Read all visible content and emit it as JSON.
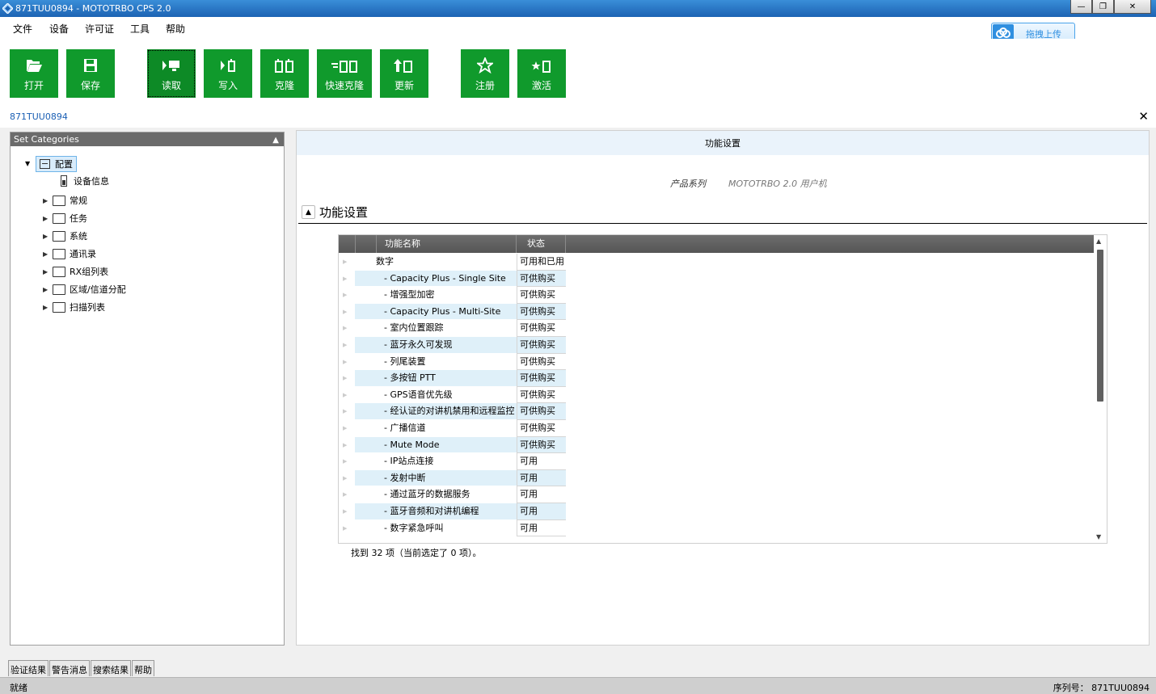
{
  "window": {
    "title": "871TUU0894 - MOTOTRBO CPS 2.0"
  },
  "menu": [
    "文件",
    "设备",
    "许可证",
    "工具",
    "帮助"
  ],
  "upload_label": "拖拽上传",
  "toolbar": {
    "open": "打开",
    "save": "保存",
    "read": "读取",
    "write": "写入",
    "clone": "克隆",
    "quick_clone": "快速克隆",
    "update": "更新",
    "register": "注册",
    "activate": "激活"
  },
  "doc_tab": "871TUU0894",
  "left_panel": {
    "title": "Set Categories",
    "root": "配置",
    "device_info": "设备信息",
    "items": [
      "常规",
      "任务",
      "系统",
      "通讯录",
      "RX组列表",
      "区域/信道分配",
      "扫描列表"
    ]
  },
  "right_panel": {
    "header": "功能设置",
    "product_series_label": "产品系列",
    "product_series_value": "MOTOTRBO 2.0 用户机",
    "section_title": "功能设置"
  },
  "grid": {
    "col_name": "功能名称",
    "col_status": "状态",
    "rows": [
      {
        "name": "数字",
        "status": "可用和已用"
      },
      {
        "name": "- Capacity Plus - Single Site",
        "status": "可供购买"
      },
      {
        "name": "- 增强型加密",
        "status": "可供购买"
      },
      {
        "name": "- Capacity Plus - Multi-Site",
        "status": "可供购买"
      },
      {
        "name": "- 室内位置跟踪",
        "status": "可供购买"
      },
      {
        "name": "- 蓝牙永久可发现",
        "status": "可供购买"
      },
      {
        "name": "- 列尾装置",
        "status": "可供购买"
      },
      {
        "name": "- 多按钮 PTT",
        "status": "可供购买"
      },
      {
        "name": "- GPS语音优先级",
        "status": "可供购买"
      },
      {
        "name": "- 经认证的对讲机禁用和远程监控",
        "status": "可供购买"
      },
      {
        "name": "- 广播信道",
        "status": "可供购买"
      },
      {
        "name": "- Mute Mode",
        "status": "可供购买"
      },
      {
        "name": "- IP站点连接",
        "status": "可用"
      },
      {
        "name": "- 发射中断",
        "status": "可用"
      },
      {
        "name": "- 通过蓝牙的数据服务",
        "status": "可用"
      },
      {
        "name": "- 蓝牙音频和对讲机编程",
        "status": "可用"
      },
      {
        "name": "- 数字紧急呼叫",
        "status": "可用"
      }
    ],
    "found_text": "找到 32 项（当前选定了 0 项）。"
  },
  "bottom_tabs": [
    "验证结果",
    "警告消息",
    "搜索结果",
    "帮助"
  ],
  "status": {
    "left": "就绪",
    "right": "序列号： 871TUU0894"
  }
}
